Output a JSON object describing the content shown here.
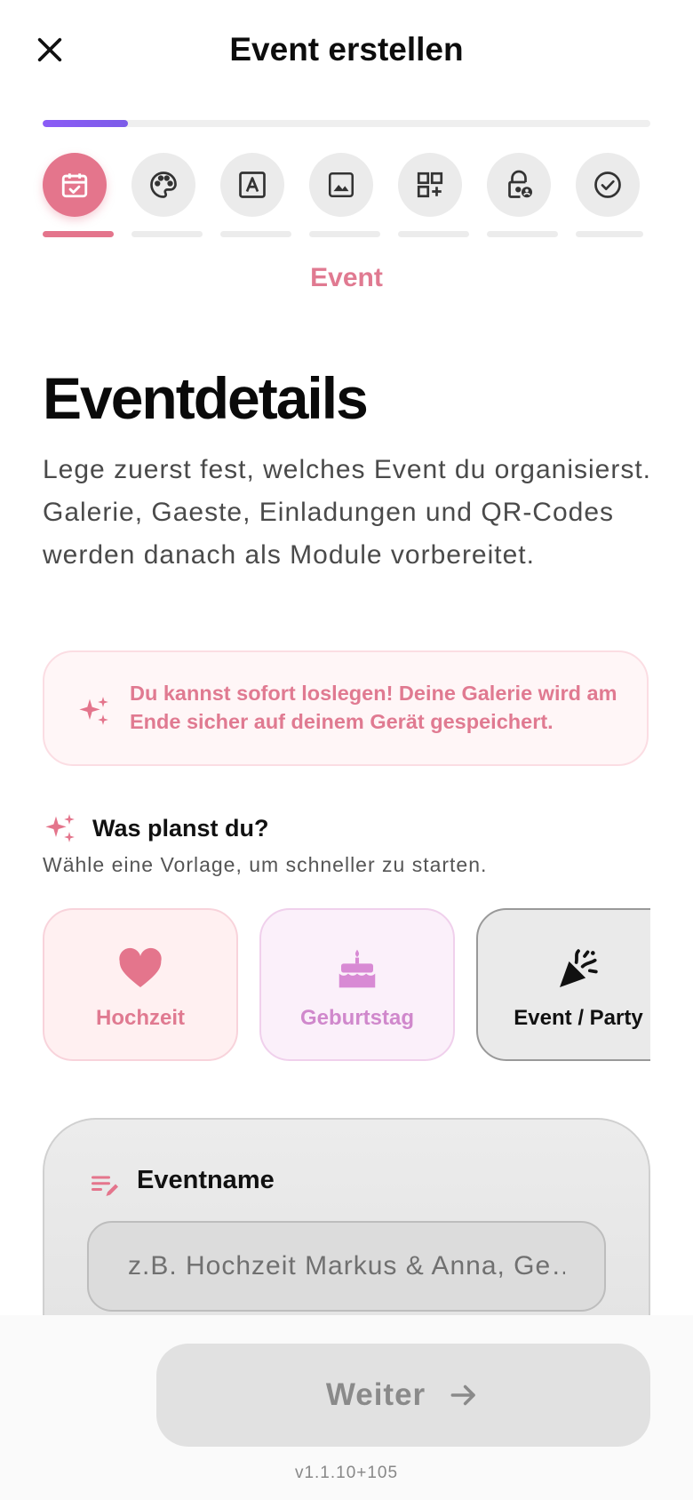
{
  "header": {
    "title": "Event erstellen",
    "close_icon": "close-icon"
  },
  "progress": {
    "fraction": 0.14,
    "color": "#8b5cf6"
  },
  "steps": [
    {
      "icon": "calendar-check-icon",
      "active": true
    },
    {
      "icon": "palette-icon",
      "active": false
    },
    {
      "icon": "text-frame-icon",
      "active": false
    },
    {
      "icon": "image-icon",
      "active": false
    },
    {
      "icon": "grid-add-icon",
      "active": false
    },
    {
      "icon": "lock-user-icon",
      "active": false
    },
    {
      "icon": "check-circle-icon",
      "active": false
    }
  ],
  "current_step_label": "Event",
  "page": {
    "title": "Eventdetails",
    "description": "Lege zuerst fest, welches Event du organisierst. Galerie, Gaeste, Einladungen und QR-Codes werden danach als Module vorbereitet."
  },
  "info": {
    "icon": "sparkles-icon",
    "text": "Du kannst sofort loslegen! Deine Galerie wird am Ende sicher auf deinem Gerät gespeichert."
  },
  "templates_section": {
    "icon": "sparkles-icon",
    "title": "Was planst du?",
    "subtitle": "Wähle eine Vorlage, um schneller zu starten."
  },
  "templates": [
    {
      "label": "Hochzeit",
      "icon": "heart-icon",
      "color": "#e4758c"
    },
    {
      "label": "Geburtstag",
      "icon": "cake-icon",
      "color": "#d88ad4"
    },
    {
      "label": "Event / Party",
      "icon": "party-popper-icon",
      "color": "#111111"
    }
  ],
  "event_name": {
    "icon": "edit-notes-icon",
    "label": "Eventname",
    "placeholder": "z.B. Hochzeit Markus & Anna, Ge…",
    "value": ""
  },
  "footer": {
    "next_label": "Weiter",
    "next_icon": "arrow-right-icon",
    "version": "v1.1.10+105"
  },
  "colors": {
    "accent": "#e4758c",
    "accent_text": "#e07a91",
    "progress": "#8b5cf6"
  }
}
